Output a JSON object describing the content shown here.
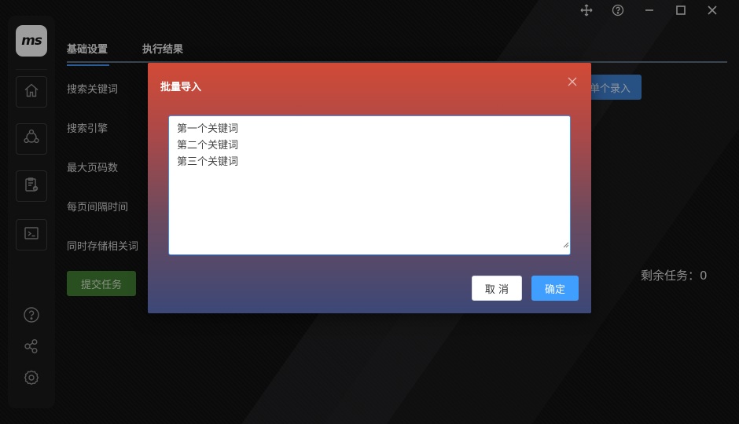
{
  "app": {
    "logo_text": "ms"
  },
  "window_controls": [
    "move-icon",
    "help-icon",
    "minimize-icon",
    "maximize-icon",
    "close-icon"
  ],
  "tabs": [
    {
      "label": "基础设置",
      "active": true
    },
    {
      "label": "执行结果",
      "active": false
    }
  ],
  "form": {
    "labels": [
      "搜索关键词",
      "搜索引擎",
      "最大页码数",
      "每页间隔时间",
      "同时存储相关词"
    ],
    "single_entry_label": "单个录入",
    "submit_label": "提交任务",
    "remaining_tasks": "剩余任务：0"
  },
  "sidebar": {
    "nav_icons": [
      "home-icon",
      "network-icon",
      "clipboard-check-icon",
      "terminal-icon"
    ],
    "bottom_icons": [
      "help-icon",
      "share-icon",
      "settings-icon"
    ]
  },
  "dialog": {
    "title": "批量导入",
    "textarea_lines": [
      "第一个关键词",
      "第二个关键词",
      "第三个关键词"
    ],
    "cancel_label": "取 消",
    "ok_label": "确定"
  },
  "colors": {
    "accent": "#409eff",
    "submit": "#3f7a32",
    "dialog_top": "#d24a36",
    "dialog_bottom": "#3c4877"
  }
}
